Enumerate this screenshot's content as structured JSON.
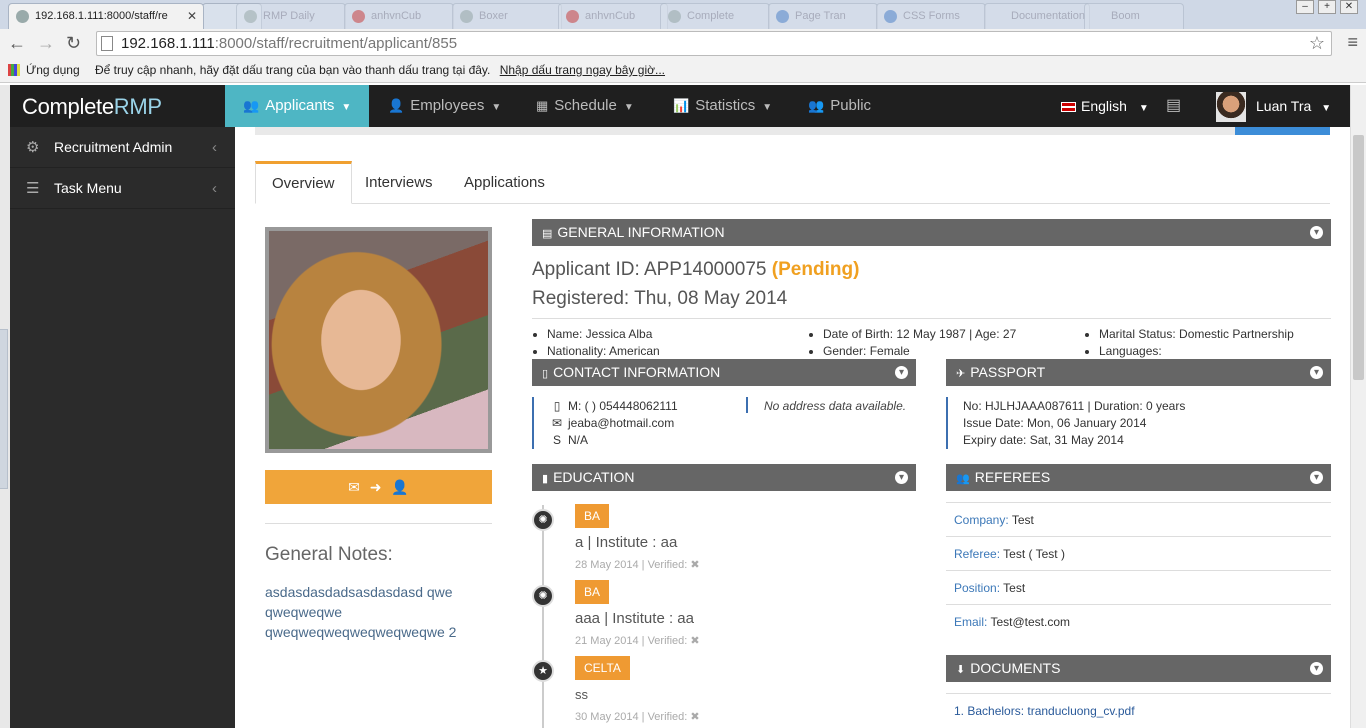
{
  "browser": {
    "tabs": [
      {
        "label": "192.168.1.111:8000/staff/re",
        "active": true
      },
      {
        "label": "",
        "active": false
      },
      {
        "label": "RMP Daily",
        "active": false
      },
      {
        "label": "anhvnCub",
        "active": false
      },
      {
        "label": "Boxer",
        "active": false
      },
      {
        "label": "anhvnCub",
        "active": false
      },
      {
        "label": "Complete",
        "active": false
      },
      {
        "label": "Page Tran",
        "active": false
      },
      {
        "label": "CSS Forms",
        "active": false
      },
      {
        "label": "Documentation",
        "active": false
      },
      {
        "label": "Boom",
        "active": false
      }
    ],
    "url_host": "192.168.1.111",
    "url_rest": ":8000/staff/recruitment/applicant/855",
    "bookmarks_apps": "Ứng dụng",
    "bookmarks_hint": "Để truy cập nhanh, hãy đặt dấu trang của bạn vào thanh dấu trang tại đây.",
    "bookmarks_link": "Nhập dấu trang ngay bây giờ..."
  },
  "app": {
    "brand_prefix": "Complete",
    "brand_suffix": "RMP",
    "nav": [
      {
        "label": "Applicants",
        "icon": "users-icon",
        "glyph": "👥",
        "active": true
      },
      {
        "label": "Employees",
        "icon": "user-icon",
        "glyph": "👤",
        "active": false
      },
      {
        "label": "Schedule",
        "icon": "calendar-icon",
        "glyph": "▦",
        "active": false
      },
      {
        "label": "Statistics",
        "icon": "bar-chart-icon",
        "glyph": "📊",
        "active": false
      },
      {
        "label": "Public",
        "icon": "group-icon",
        "glyph": "👥",
        "active": false
      }
    ],
    "language": "English",
    "user_name": "Luan Tra"
  },
  "sidebar": {
    "items": [
      {
        "label": "Recruitment Admin",
        "icon": "gear-icon"
      },
      {
        "label": "Task Menu",
        "icon": "menu-icon"
      }
    ]
  },
  "tabs": [
    "Overview",
    "Interviews",
    "Applications"
  ],
  "notes": {
    "title": "General Notes:",
    "body": "asdasdasdadsasdasdasd qwe qweqweqwe qweqweqweqweqweqweqwe 2"
  },
  "general": {
    "heading": "GENERAL INFORMATION",
    "applicant_id": "Applicant ID: APP14000075",
    "status": "(Pending)",
    "registered": "Registered: Thu, 08 May 2014",
    "col1": [
      "Name: Jessica Alba",
      "Nationality: American"
    ],
    "col2": [
      "Date of Birth: 12 May 1987 | Age: 27",
      "Gender: Female"
    ],
    "col3": [
      "Marital Status: Domestic Partnership",
      "Languages:"
    ]
  },
  "contact": {
    "heading": "CONTACT INFORMATION",
    "mobile": "M: ( ) 054448062111",
    "email": "jeaba@hotmail.com",
    "skype": "N/A",
    "address": "No address data available."
  },
  "passport": {
    "heading": "PASSPORT",
    "line1": "No: HJLHJAAA087611 | Duration: 0 years",
    "line2": "Issue Date: Mon, 06 January 2014",
    "line3": "Expiry date: Sat, 31 May 2014"
  },
  "education": {
    "heading": "EDUCATION",
    "items": [
      {
        "badge": "BA",
        "title": "a | Institute : aa",
        "meta": "28 May 2014 | Verified:",
        "icon": "sun-icon"
      },
      {
        "badge": "BA",
        "title": "aaa | Institute : aa",
        "meta": "21 May 2014 | Verified:",
        "icon": "sun-icon"
      },
      {
        "badge": "CELTA",
        "title": "ss",
        "meta": "30 May 2014 | Verified:",
        "icon": "star-icon"
      }
    ]
  },
  "referees": {
    "heading": "REFEREES",
    "rows": [
      {
        "label": "Company:",
        "value": "Test"
      },
      {
        "label": "Referee:",
        "value": "Test ( Test )"
      },
      {
        "label": "Position:",
        "value": "Test"
      },
      {
        "label": "Email:",
        "value": "Test@test.com"
      }
    ]
  },
  "documents": {
    "heading": "DOCUMENTS",
    "items": [
      "1. Bachelors: tranducluong_cv.pdf"
    ]
  },
  "colors": {
    "accent": "#4eb6c4",
    "orange": "#f0a53a",
    "panel": "#666666",
    "link": "#3c78b8"
  }
}
